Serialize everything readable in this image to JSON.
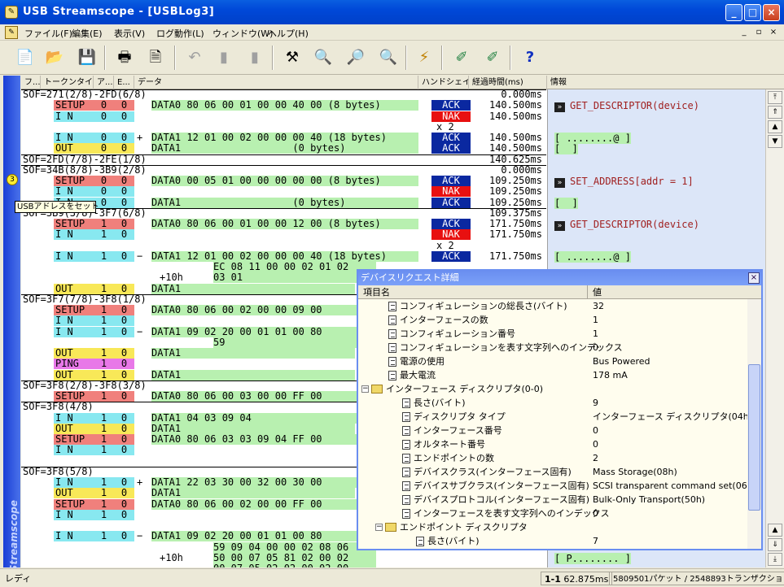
{
  "window": {
    "title": "USB Streamscope - [USBLog3]",
    "min": "_",
    "max": "□",
    "close": "×"
  },
  "menu": {
    "items": [
      "ファイル(F)",
      "編集(E)",
      "表示(V)",
      "ログ動作(L)",
      "ウィンドウ(W)",
      "ヘルプ(H)"
    ],
    "mdi": [
      "_",
      "▫",
      "×"
    ]
  },
  "toolbar": {
    "icons": [
      "new-icon",
      "open-icon",
      "save-icon",
      "print-icon",
      "preview-icon",
      "undo-icon",
      "copy-icon",
      "paste-icon",
      "settings-icon",
      "find-icon",
      "zoom-in-icon",
      "zoom-out-icon",
      "filter-icon",
      "mark-icon",
      "unmark-icon",
      "help-icon"
    ]
  },
  "sidebar": {
    "label": "USB Streamscope"
  },
  "columns": [
    "フ...",
    "トークンタイプ",
    "ア...",
    "E...",
    "データ",
    "ハンドシェイク",
    "経過時間(ms)",
    "情報"
  ],
  "rows": [
    {
      "type": "sof",
      "text": "SOF=271(2/8)-2FD(6/8)",
      "time": "0.000ms"
    },
    {
      "type": "tx",
      "token": "SETUP",
      "tc": "r",
      "addr": "0",
      "ep": "0",
      "data": "DATA0 80 06 00 01 00 00 40 00 (8 bytes)",
      "hs": "ACK",
      "time": "140.500ms"
    },
    {
      "type": "tx",
      "token": "I N",
      "tc": "c",
      "addr": "0",
      "ep": "0",
      "data": "",
      "hs": "NAK",
      "time": "140.500ms"
    },
    {
      "type": "x2",
      "text": "x 2"
    },
    {
      "type": "tx",
      "token": "I N",
      "tc": "c",
      "addr": "0",
      "ep": "0",
      "exp": "+",
      "data": "DATA1 12 01 00 02 00 00 00 40 (18 bytes)",
      "hs": "ACK",
      "time": "140.500ms"
    },
    {
      "type": "tx",
      "token": "OUT",
      "tc": "y",
      "addr": "0",
      "ep": "0",
      "data": "DATA1                   (0 bytes)",
      "hs": "ACK",
      "time": "140.500ms"
    },
    {
      "type": "sof",
      "text": "SOF=2FD(7/8)-2FE(1/8)",
      "time": "140.625ms"
    },
    {
      "type": "sof",
      "text": "SOF=34B(8/8)-3B9(2/8)",
      "time": "0.000ms"
    },
    {
      "type": "tx",
      "token": "SETUP",
      "tc": "r",
      "addr": "0",
      "ep": "0",
      "data": "DATA0 00 05 01 00 00 00 00 00 (8 bytes)",
      "hs": "ACK",
      "time": "109.250ms"
    },
    {
      "type": "tx",
      "token": "I N",
      "tc": "c",
      "addr": "0",
      "ep": "0",
      "data": "",
      "hs": "NAK",
      "time": "109.250ms"
    },
    {
      "type": "tx",
      "token": "I N",
      "tc": "c",
      "addr": "0",
      "ep": "0",
      "data": "DATA1                   (0 bytes)",
      "hs": "ACK",
      "time": "109.250ms"
    },
    {
      "type": "sof",
      "text": "SOF=3B9(3/8)-3F7(6/8)",
      "time": "109.375ms"
    },
    {
      "type": "tx",
      "token": "SETUP",
      "tc": "r",
      "addr": "1",
      "ep": "0",
      "data": "DATA0 80 06 00 01 00 00 12 00 (8 bytes)",
      "hs": "ACK",
      "time": "171.750ms"
    },
    {
      "type": "tx",
      "token": "I N",
      "tc": "c",
      "addr": "1",
      "ep": "0",
      "data": "",
      "hs": "NAK",
      "time": "171.750ms"
    },
    {
      "type": "x2",
      "text": "x 2"
    },
    {
      "type": "tx",
      "token": "I N",
      "tc": "c",
      "addr": "1",
      "ep": "0",
      "exp": "−",
      "data": "DATA1 12 01 00 02 00 00 00 40 (18 bytes)",
      "hs": "ACK",
      "time": "171.750ms"
    },
    {
      "type": "cont",
      "data": "EC 08 11 00 00 02 01 02"
    },
    {
      "type": "cont2",
      "off": "+10h",
      "data": "03 01"
    },
    {
      "type": "tx",
      "token": "OUT",
      "tc": "y",
      "addr": "1",
      "ep": "0",
      "data": "DATA1",
      "hs": "",
      "time": ""
    },
    {
      "type": "sof",
      "text": "SOF=3F7(7/8)-3F8(1/8)",
      "time": ""
    },
    {
      "type": "tx",
      "token": "SETUP",
      "tc": "r",
      "addr": "1",
      "ep": "0",
      "data": "DATA0 80 06 00 02 00 00 09 00",
      "hs": "",
      "time": ""
    },
    {
      "type": "tx",
      "token": "I N",
      "tc": "c",
      "addr": "1",
      "ep": "0",
      "data": "",
      "hs": "",
      "time": ""
    },
    {
      "type": "tx",
      "token": "I N",
      "tc": "c",
      "addr": "1",
      "ep": "0",
      "exp": "−",
      "data": "DATA1 09 02 20 00 01 01 00 80",
      "hs": "",
      "time": ""
    },
    {
      "type": "cont",
      "data": "59"
    },
    {
      "type": "tx",
      "token": "OUT",
      "tc": "y",
      "addr": "1",
      "ep": "0",
      "data": "DATA1",
      "hs": "",
      "time": ""
    },
    {
      "type": "tx",
      "token": "PING",
      "tc": "m",
      "addr": "1",
      "ep": "0",
      "data": "",
      "hs": "",
      "time": ""
    },
    {
      "type": "tx",
      "token": "OUT",
      "tc": "y",
      "addr": "1",
      "ep": "0",
      "data": "DATA1",
      "hs": "",
      "time": ""
    },
    {
      "type": "sof",
      "text": "SOF=3F8(2/8)-3F8(3/8)",
      "time": ""
    },
    {
      "type": "tx",
      "token": "SETUP",
      "tc": "r",
      "addr": "1",
      "ep": "0",
      "data": "DATA0 80 06 00 03 00 00 FF 00",
      "hs": "",
      "time": ""
    },
    {
      "type": "sof",
      "text": "SOF=3F8(4/8)",
      "time": ""
    },
    {
      "type": "tx",
      "token": "I N",
      "tc": "c",
      "addr": "1",
      "ep": "0",
      "data": "DATA1 04 03 09 04",
      "hs": "",
      "time": ""
    },
    {
      "type": "tx",
      "token": "OUT",
      "tc": "y",
      "addr": "1",
      "ep": "0",
      "data": "DATA1",
      "hs": "",
      "time": ""
    },
    {
      "type": "tx",
      "token": "SETUP",
      "tc": "r",
      "addr": "1",
      "ep": "0",
      "data": "DATA0 80 06 03 03 09 04 FF 00",
      "hs": "",
      "time": ""
    },
    {
      "type": "tx",
      "token": "I N",
      "tc": "c",
      "addr": "1",
      "ep": "0",
      "data": "",
      "hs": "",
      "time": ""
    },
    {
      "type": "blank"
    },
    {
      "type": "sof",
      "text": "SOF=3F8(5/8)",
      "time": ""
    },
    {
      "type": "tx",
      "token": "I N",
      "tc": "c",
      "addr": "1",
      "ep": "0",
      "exp": "+",
      "data": "DATA1 22 03 30 00 32 00 30 00",
      "hs": "",
      "time": ""
    },
    {
      "type": "tx",
      "token": "OUT",
      "tc": "y",
      "addr": "1",
      "ep": "0",
      "data": "DATA1",
      "hs": "",
      "time": ""
    },
    {
      "type": "tx",
      "token": "SETUP",
      "tc": "r",
      "addr": "1",
      "ep": "0",
      "data": "DATA0 80 06 00 02 00 00 FF 00",
      "hs": "",
      "time": ""
    },
    {
      "type": "tx",
      "token": "I N",
      "tc": "c",
      "addr": "1",
      "ep": "0",
      "data": "",
      "hs": "",
      "time": ""
    },
    {
      "type": "blank"
    },
    {
      "type": "tx",
      "token": "I N",
      "tc": "c",
      "addr": "1",
      "ep": "0",
      "exp": "−",
      "data": "DATA1 09 02 20 00 01 01 00 80",
      "hs": "",
      "time": ""
    },
    {
      "type": "cont",
      "data": "59 09 04 00 00 02 08 06"
    },
    {
      "type": "cont2",
      "off": "+10h",
      "data": "50 00 07 05 81 02 00 02"
    },
    {
      "type": "cont",
      "data": "00 07 05 02 02 00 02 00"
    }
  ],
  "info": [
    {
      "row": 1,
      "kind": "arrow",
      "text": "GET_DESCRIPTOR(device)"
    },
    {
      "row": 4,
      "kind": "data",
      "text": "[ ........@ ]"
    },
    {
      "row": 5,
      "kind": "data",
      "text": "[  ]"
    },
    {
      "row": 8,
      "kind": "arrow",
      "text": "SET_ADDRESS[addr = 1]"
    },
    {
      "row": 10,
      "kind": "data",
      "text": "[  ]"
    },
    {
      "row": 12,
      "kind": "arrow",
      "text": "GET_DESCRIPTOR(device)"
    },
    {
      "row": 15,
      "kind": "data",
      "text": "[ ........@ ]"
    },
    {
      "row": 43,
      "kind": "data",
      "text": "[ P........ ]"
    }
  ],
  "marker": {
    "label": "3"
  },
  "tooltip": {
    "text": "USBアドレスをセット"
  },
  "dialog": {
    "title": "デバイスリクエスト詳細",
    "col_name": "項目名",
    "col_value": "値",
    "rows": [
      {
        "lvl": 3,
        "ic": "doc",
        "name": "コンフィギュレーションの総長さ(バイト)",
        "value": "32"
      },
      {
        "lvl": 3,
        "ic": "doc",
        "name": "インターフェースの数",
        "value": "1"
      },
      {
        "lvl": 3,
        "ic": "doc",
        "name": "コンフィギュレーション番号",
        "value": "1"
      },
      {
        "lvl": 3,
        "ic": "doc",
        "name": "コンフィギュレーションを表す文字列へのインデックス",
        "value": "0"
      },
      {
        "lvl": 3,
        "ic": "doc",
        "name": "電源の使用",
        "value": "Bus Powered"
      },
      {
        "lvl": 3,
        "ic": "doc",
        "name": "最大電流",
        "value": "178 mA"
      },
      {
        "lvl": 2,
        "ic": "fold",
        "name": "インターフェース ディスクリプタ(0-0)",
        "value": ""
      },
      {
        "lvl": 4,
        "ic": "doc",
        "name": "長さ(バイト)",
        "value": "9"
      },
      {
        "lvl": 4,
        "ic": "doc",
        "name": "ディスクリプタ タイプ",
        "value": "インターフェース ディスクリプタ(04h)"
      },
      {
        "lvl": 4,
        "ic": "doc",
        "name": "インターフェース番号",
        "value": "0"
      },
      {
        "lvl": 4,
        "ic": "doc",
        "name": "オルタネート番号",
        "value": "0"
      },
      {
        "lvl": 4,
        "ic": "doc",
        "name": "エンドポイントの数",
        "value": "2"
      },
      {
        "lvl": 4,
        "ic": "doc",
        "name": "デバイスクラス(インターフェース固有)",
        "value": "Mass Storage(08h)"
      },
      {
        "lvl": 4,
        "ic": "doc",
        "name": "デバイスサブクラス(インターフェース固有)",
        "value": "SCSI transparent command set(06h)"
      },
      {
        "lvl": 4,
        "ic": "doc",
        "name": "デバイスプロトコル(インターフェース固有)",
        "value": "Bulk-Only Transport(50h)"
      },
      {
        "lvl": 4,
        "ic": "doc",
        "name": "インターフェースを表す文字列へのインデックス",
        "value": "0"
      },
      {
        "lvl": 3,
        "ic": "fold",
        "name": "エンドポイント ディスクリプタ",
        "value": ""
      },
      {
        "lvl": 5,
        "ic": "doc",
        "name": "長さ(バイト)",
        "value": "7"
      }
    ]
  },
  "status": {
    "ready": "レディ",
    "pos": "1-1",
    "time": "62.875ms",
    "counts": "5809501パケット / 2548893トランザクション"
  }
}
